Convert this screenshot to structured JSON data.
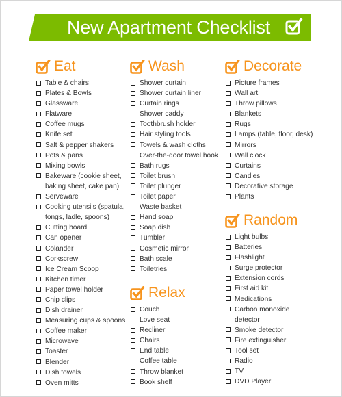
{
  "title": "New Apartment Checklist",
  "colors": {
    "banner": "#7cbb00",
    "accent": "#f7941d",
    "text": "#333333"
  },
  "icons": {
    "title_icon": "check-box-icon",
    "section_icon": "check-box-icon",
    "item_icon": "empty-checkbox-icon"
  },
  "columns": [
    {
      "sections": [
        {
          "title": "Eat",
          "items": [
            "Table & chairs",
            "Plates & Bowls",
            "Glassware",
            "Flatware",
            "Coffee mugs",
            "Knife set",
            "Salt & pepper shakers",
            "Pots & pans",
            "Mixing bowls",
            "Bakeware (cookie sheet,\nbaking sheet, cake pan)",
            "Serveware",
            "Cooking utensils (spatula,\ntongs, ladle, spoons)",
            "Cutting board",
            "Can opener",
            "Colander",
            "Corkscrew",
            "Ice Cream Scoop",
            "Kitchen timer",
            "Paper towel holder",
            "Chip clips",
            "Dish drainer",
            "Measuring cups & spoons",
            "Coffee maker",
            "Microwave",
            "Toaster",
            "Blender",
            "Dish towels",
            "Oven mitts"
          ]
        }
      ]
    },
    {
      "sections": [
        {
          "title": "Wash",
          "items": [
            "Shower curtain",
            "Shower curtain liner",
            "Curtain rings",
            "Shower caddy",
            "Toothbrush holder",
            "Hair styling tools",
            "Towels & wash cloths",
            "Over-the-door towel hook",
            "Bath rugs",
            "Toilet brush",
            "Toilet plunger",
            "Toilet paper",
            "Waste basket",
            "Hand soap",
            "Soap dish",
            "Tumbler",
            "Cosmetic mirror",
            "Bath scale",
            "Toiletries"
          ]
        },
        {
          "title": "Relax",
          "items": [
            "Couch",
            "Love seat",
            "Recliner",
            "Chairs",
            "End table",
            "Coffee table",
            "Throw blanket",
            "Book shelf"
          ]
        }
      ]
    },
    {
      "sections": [
        {
          "title": "Decorate",
          "items": [
            "Picture frames",
            "Wall art",
            "Throw pillows",
            "Blankets",
            "Rugs",
            "Lamps (table, floor, desk)",
            "Mirrors",
            "Wall clock",
            "Curtains",
            "Candles",
            "Decorative storage",
            "Plants"
          ]
        },
        {
          "title": "Random",
          "items": [
            "Light bulbs",
            "Batteries",
            "Flashlight",
            "Surge protector",
            "Extension cords",
            "First aid kit",
            "Medications",
            "Carbon monoxide\ndetector",
            "Smoke detector",
            "Fire extinguisher",
            "Tool set",
            "Radio",
            "TV",
            "DVD Player"
          ]
        }
      ]
    }
  ]
}
